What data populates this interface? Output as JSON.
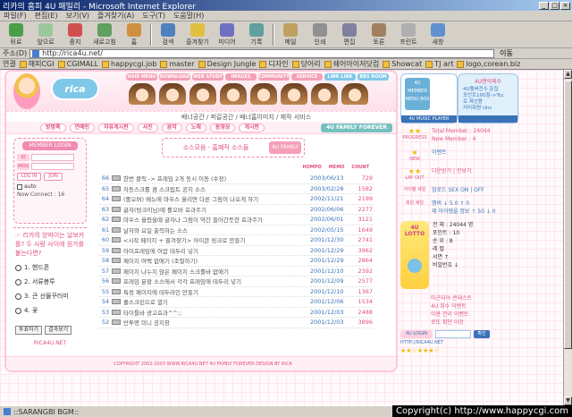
{
  "window": {
    "title": "리카의 홈피 4U 패밀리 - Microsoft Internet Explorer",
    "buttons": [
      "_",
      "□",
      "×"
    ]
  },
  "menu": [
    "파일(F)",
    "편집(E)",
    "보기(V)",
    "즐겨찾기(A)",
    "도구(T)",
    "도움말(H)"
  ],
  "toolbar": [
    "뒤로",
    "앞으로",
    "중지",
    "새로고침",
    "홈",
    "검색",
    "즐겨찾기",
    "미디어",
    "기록",
    "메일",
    "인쇄",
    "편집",
    "토론",
    "프린트",
    "새창"
  ],
  "address": {
    "label": "주소(D)",
    "url": "http://ricа4u.net/",
    "go": "이동"
  },
  "links": {
    "label": "연결",
    "items": [
      "해피CGI",
      "CGIMALL",
      "happycgi.job",
      "master",
      "Design Jungle",
      "디자인",
      "당어리",
      "쉐어아이저닷컴",
      "Showcat",
      "TJ art",
      "logo,corean.biz"
    ]
  },
  "site": {
    "logo": "rica",
    "nav_tabs": [
      "HAIR MENU",
      "DOWNLOAD",
      "WEB STUDY",
      "IMAGES",
      "COMMUNITY",
      "SERVICE",
      "LINK LINK",
      "BBS ROOM"
    ],
    "subnav": "배너공간 / 퍼갈공간 / 배너홈이미지 / 제작 서비스",
    "categories": [
      "방명록",
      "연예인",
      "자유게시판",
      "사진",
      "음악",
      "노래",
      "동영상",
      "게시판"
    ],
    "family_badge": "4U FAMILY FOREVER",
    "login": {
      "title": "MEMBER LOGIN",
      "id": "ID",
      "pass": "PASS",
      "login_btn": "LOG IN",
      "join_btn": "JOIN",
      "auto": "auto",
      "now_connect": "Now Connect : 16"
    },
    "poll": {
      "question": "☞ 리카의 양파이는 날보카를? 두 사람 사이에 원가를 붙는다면?",
      "options": [
        "1. 핸드폰",
        "2. 서류봉투",
        "3. 큰 선물꾸러미",
        "4. 꽃"
      ],
      "vote": "투표하기",
      "result": "결과보기",
      "counter": "RICA4U.NET"
    },
    "board": {
      "title": "소스모음 - 홈폐작 소스들",
      "family": "4U FAMILY",
      "headers": [
        "HOMPO",
        "MEMO",
        "COUNT"
      ],
      "rows": [
        {
          "no": "66",
          "subject": "한번 클릭 -> 프레임 2개 동시 이동 (수정)",
          "date": "2003/06/13",
          "hits": "729"
        },
        {
          "no": "65",
          "subject": "자동스크롤 겸 스크립트 공지 소스",
          "date": "2003/02/28",
          "hits": "1582"
        },
        {
          "no": "64",
          "subject": "(롤오버) 메뉴에 마우스 올리면 다른 그림이 나오게 하기",
          "date": "2002/11/21",
          "hits": "2199"
        },
        {
          "no": "63",
          "subject": "글자(텅크이님)에 롤오버 효과주기",
          "date": "2002/06/06",
          "hits": "2277"
        },
        {
          "no": "62",
          "subject": "마우스 올렸을때 글자나 그림이 약간 들어간듯한 효과주기",
          "date": "2002/06/01",
          "hits": "3121"
        },
        {
          "no": "61",
          "subject": "날자와 요일 출력하는 소스",
          "date": "2002/05/15",
          "hits": "1649"
        },
        {
          "no": "60",
          "subject": "<시작 페이지 + 즐겨찾기> 아이콘 링크로 만들기",
          "date": "2001/12/30",
          "hits": "2741"
        },
        {
          "no": "59",
          "subject": "아이프레임에 여잡 테두리 넣기",
          "date": "2001/12/29",
          "hits": "3962"
        },
        {
          "no": "58",
          "subject": "페이지 여백 없애기 (조절하기)",
          "date": "2001/12/29",
          "hits": "2864"
        },
        {
          "no": "57",
          "subject": "페이지 나누지 않은 페이지 스크롤바 없애기",
          "date": "2001/12/10",
          "hits": "2392"
        },
        {
          "no": "56",
          "subject": "프레임 분할 소스에서 각각 프레임에 테두리 넣기",
          "date": "2001/12/09",
          "hits": "2577"
        },
        {
          "no": "55",
          "subject": "특정 페이지에 테두라인 만들기",
          "date": "2001/12/10",
          "hits": "1367"
        },
        {
          "no": "54",
          "subject": "풀스크린으로 열기",
          "date": "2001/12/06",
          "hits": "1534"
        },
        {
          "no": "53",
          "subject": "타이틀바 광고효과^^;;",
          "date": "2001/12/03",
          "hits": "2488"
        },
        {
          "no": "52",
          "subject": "반투명 미니 공지창",
          "date": "2001/12/03",
          "hits": "3896"
        }
      ]
    },
    "footer": "COPYRIGHT 2002-2003 WWW.RICA4U.NET  4U FAMILY FOREVER  DESIGN BY RICA"
  },
  "right": {
    "member_box": "4U MEMBER MENU BOX",
    "music_bar": "4U MUSIC PLAYER",
    "mp_title": "4U맨의제수",
    "mp_lines": [
      "4U멤버전수 운집",
      "포인트100점->Tcc",
      "로 제선용",
      "커미화원 Unc"
    ],
    "progress_label": "PROGRESS",
    "total": "Total Member : 24044",
    "new": "New Member : 4",
    "new_label": "NEW",
    "event_label": "LAY OUT",
    "event_text": "이벤트",
    "item1": "다운받기 | 전보기",
    "item2": "아이템 세일",
    "item2_text": "업로드 SEX ON | OFF",
    "item3": "회원 세일",
    "item3_lines": [
      "멤버 ↓ 5.0 ↑ 0",
      "제 아이템을 정보 ↑ 50 ↓ 0"
    ],
    "lotto": "4U LOTTO",
    "info": [
      "전 체 : 24044 명",
      "포인트 : 10",
      "순 위 : 8",
      "레 벨",
      "서면 ↑",
      "비밀번호 ↓"
    ],
    "notices": [
      "마곤되어 콘테스트",
      "4U 회수 이벤트",
      "이용 관리 이벤트",
      "로또 확인 이강"
    ],
    "login_label": "4U LOGIN",
    "login_ok": "확인",
    "http": "HTTP://RICA4U.NET",
    "stars": "★★☆★★★☆"
  },
  "status": {
    "text": "::SARANGBI BGM::",
    "watermark": "Copyright(c) http://www.happycgi.com"
  },
  "colors": {
    "pink": "#e05080",
    "blue": "#3a72b8",
    "rose": "#f08ab0"
  }
}
